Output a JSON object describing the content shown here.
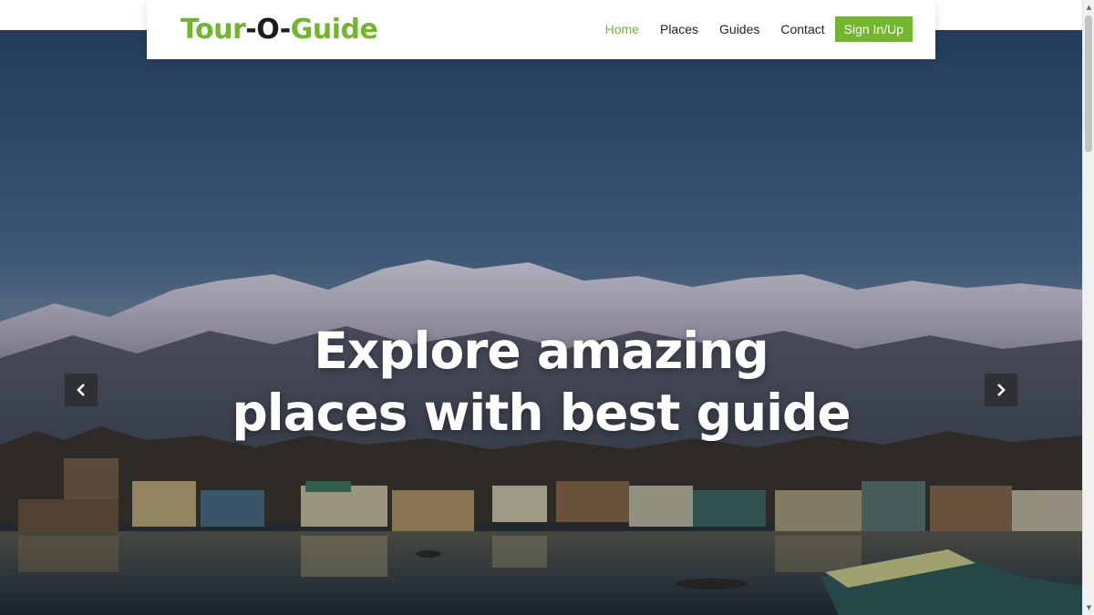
{
  "colors": {
    "accent": "#72b62e"
  },
  "brand": {
    "part1": "Tour",
    "sep1": "-",
    "part2": "O",
    "sep2": "-",
    "part3": "Guide"
  },
  "nav": {
    "items": [
      {
        "label": "Home",
        "active": true
      },
      {
        "label": "Places",
        "active": false
      },
      {
        "label": "Guides",
        "active": false
      },
      {
        "label": "Contact",
        "active": false
      }
    ],
    "signin_label": "Sign In/Up"
  },
  "hero": {
    "title_line1": "Explore amazing",
    "title_line2": "places with best guide",
    "prev_icon": "chevron-left-icon",
    "next_icon": "chevron-right-icon"
  }
}
